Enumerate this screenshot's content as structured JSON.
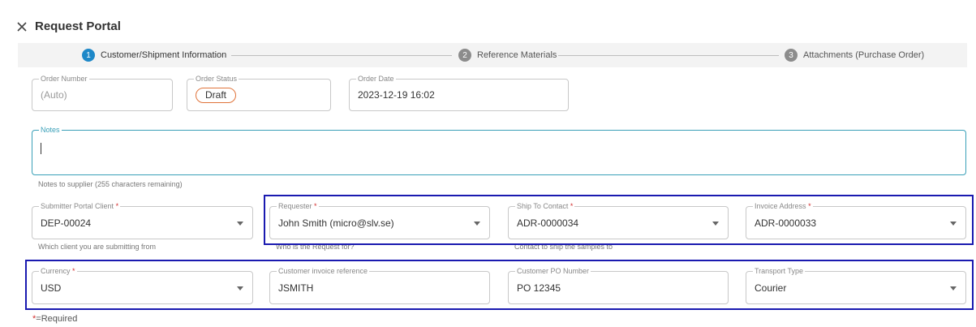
{
  "header": {
    "title": "Request Portal"
  },
  "steps": [
    {
      "number": "1",
      "label": "Customer/Shipment Information"
    },
    {
      "number": "2",
      "label": "Reference Materials"
    },
    {
      "number": "3",
      "label": "Attachments (Purchase Order)"
    }
  ],
  "order_number": {
    "label": "Order Number",
    "value": "(Auto)"
  },
  "order_status": {
    "label": "Order Status",
    "value": "Draft"
  },
  "order_date": {
    "label": "Order Date",
    "value": "2023-12-19 16:02"
  },
  "notes": {
    "label": "Notes",
    "value": "",
    "helper": "Notes to supplier (255 characters remaining)"
  },
  "submitter_client": {
    "label": "Submitter Portal Client",
    "value": "DEP-00024",
    "helper": "Which client you are submitting from"
  },
  "requester": {
    "label": "Requester",
    "value": "John Smith (micro@slv.se)",
    "helper": "Who is the Request for?"
  },
  "ship_to_contact": {
    "label": "Ship To Contact",
    "value": "ADR-0000034",
    "helper": "Contact to ship the samples to"
  },
  "invoice_address": {
    "label": "Invoice Address",
    "value": "ADR-0000033"
  },
  "currency": {
    "label": "Currency",
    "value": "USD"
  },
  "customer_invoice_reference": {
    "label": "Customer invoice reference",
    "value": "JSMITH"
  },
  "customer_po_number": {
    "label": "Customer PO Number",
    "value": "PO 12345"
  },
  "transport_type": {
    "label": "Transport Type",
    "value": "Courier"
  },
  "required_marker": "*",
  "required_note": "=Required",
  "colors": {
    "accent": "#1e88c8",
    "highlight": "#1a1ab0",
    "draft_badge": "#e0733a",
    "required": "#d32f2f"
  }
}
